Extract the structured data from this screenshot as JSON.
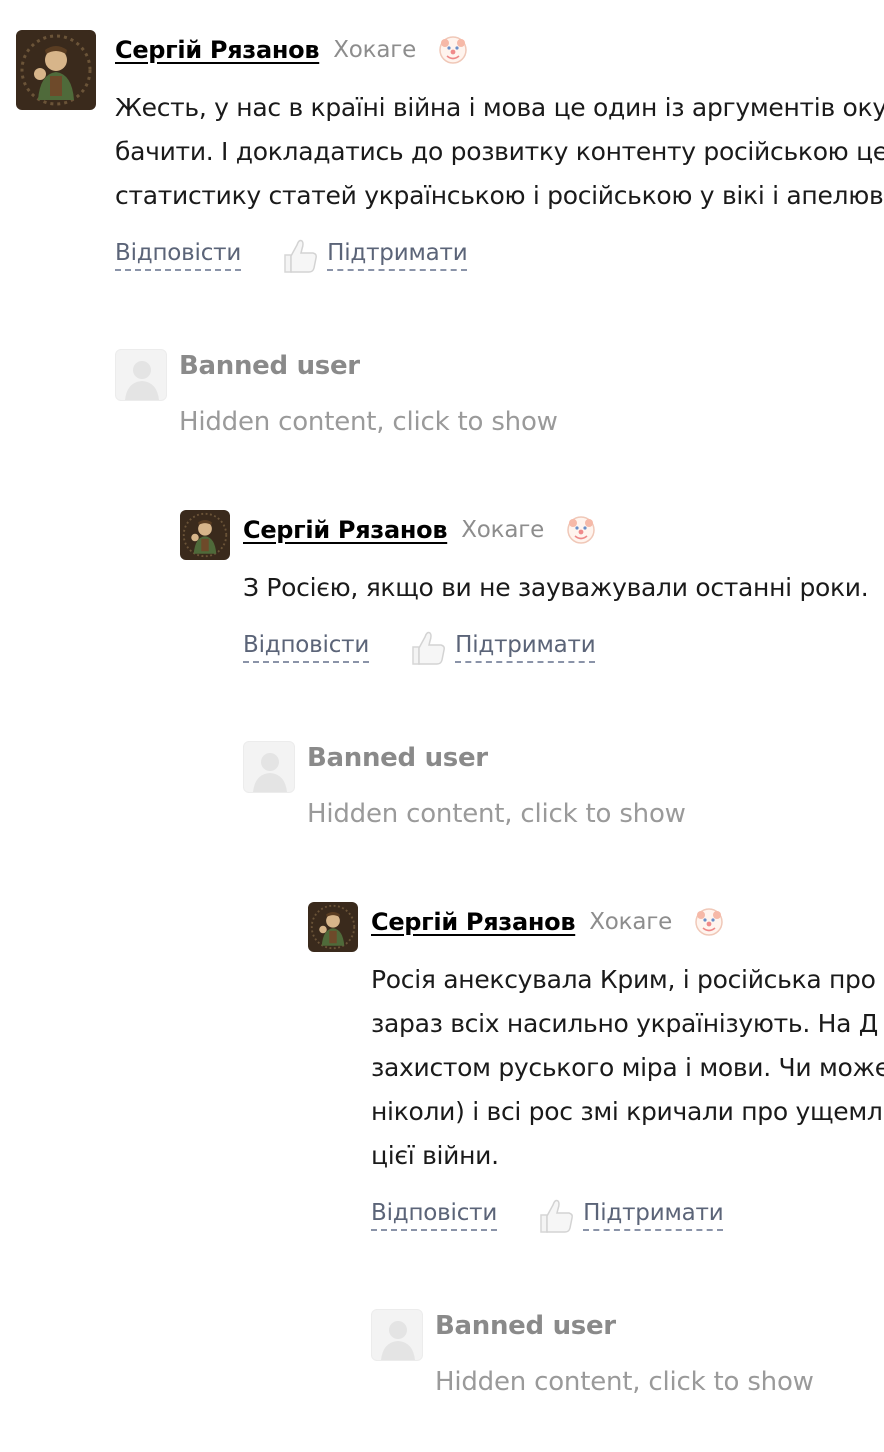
{
  "comments": [
    {
      "author": "Сергій Рязанов",
      "rank": "Хокаге",
      "badge_icon": "clown-badge-icon",
      "body_lines": [
        "Жесть, у нас в країні війна і мова це один із аргументів оку",
        "бачити. І докладатись до розвитку контенту російською це",
        "статистику статей українською і російською у вікі і апелюв"
      ],
      "reply_label": "Відповісти",
      "like_label": "Підтримати"
    },
    {
      "author": "Сергій Рязанов",
      "rank": "Хокаге",
      "badge_icon": "clown-badge-icon",
      "body_lines": [
        "З Росією, якщо ви не зауважували останні роки."
      ],
      "reply_label": "Відповісти",
      "like_label": "Підтримати"
    },
    {
      "author": "Сергій Рязанов",
      "rank": "Хокаге",
      "badge_icon": "clown-badge-icon",
      "body_lines": [
        "Росія анексувала Крим, і російська про",
        "зараз всіх насильно українізують. На Д",
        "захистом руського міра і мови. Чи може",
        "ніколи) і всі рос змі кричали про ущемл",
        "цієї війни."
      ],
      "reply_label": "Відповісти",
      "like_label": "Підтримати"
    }
  ],
  "banned": [
    {
      "name": "Banned user",
      "hidden_label": "Hidden content, click to show"
    },
    {
      "name": "Banned user",
      "hidden_label": "Hidden content, click to show"
    },
    {
      "name": "Banned user",
      "hidden_label": "Hidden content, click to show"
    }
  ],
  "colors": {
    "author": "#000000",
    "rank": "#8d8d8d",
    "action_link": "#5b6478",
    "banned_text": "#8a8a8a",
    "avatar_bg": "#3a2a1c"
  }
}
